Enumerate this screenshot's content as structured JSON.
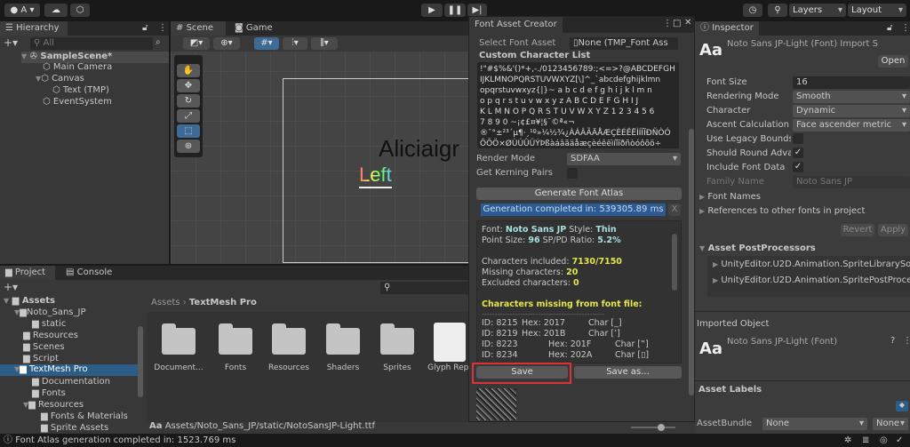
{
  "toolbar": {
    "account_label": "A",
    "play_icon": "play-icon",
    "pause_icon": "pause-icon",
    "step_icon": "step-icon",
    "layers": "Layers",
    "layout": "Layout"
  },
  "hierarchy": {
    "tab": "Hierarchy",
    "search_placeholder": "All",
    "items": [
      {
        "label": "SampleScene*"
      },
      {
        "label": "Main Camera"
      },
      {
        "label": "Canvas"
      },
      {
        "label": "Text (TMP)"
      },
      {
        "label": "EventSystem"
      }
    ]
  },
  "scene": {
    "tabs": [
      "Scene",
      "Game"
    ],
    "text1": "Aliciaigr",
    "text2": "Left"
  },
  "project": {
    "tabs": [
      "Project",
      "Console"
    ],
    "tree": [
      "Assets",
      "Noto_Sans_JP",
      "static",
      "Resources",
      "Scenes",
      "Script",
      "TextMesh Pro",
      "Documentation",
      "Fonts",
      "Resources",
      "Fonts & Materials",
      "Sprite Assets"
    ],
    "breadcrumb": [
      "Assets",
      "TextMesh Pro"
    ],
    "items": [
      "Document...",
      "Fonts",
      "Resources",
      "Shaders",
      "Sprites",
      "Glyph Repo"
    ],
    "footer_path": "Assets/Noto_Sans_JP/static/NotoSansJP-Light.ttf",
    "footer_icon": "Aa"
  },
  "status": {
    "message": "Font Atlas generation completed in: 1523.769 ms"
  },
  "fac": {
    "title": "Font Asset Creator",
    "select_label": "Select Font Asset",
    "select_value": "None (TMP_Font Ass",
    "ccl_label": "Custom Character List",
    "ccl_lines": [
      "!\"#$%&'()*+,-./0123456789:;<=>?@ABCDEFGH",
      "IJKLMNOPQRSTUVWXYZ[\\]^_`abcdefghijklmn",
      "opqrstuvwxyz{|}~ a b c d e f g h i j k l m n",
      "o p q r s t u v w x y z A B C D E F G H I J",
      "K L M N O P Q R S T U V W X Y Z 1 2 3 4 5 6",
      "7 8 9 0 ~¡¢£¤¥¦§¨©ª«¬",
      "®¯°±²³´µ¶·¸¹º»¼½¾¿ÀÁÂÃÄÅÆÇÈÉÊËÌÍÎÏÐÑÒÓ",
      "ÔÕÖ×ØÙÚÛÜÝÞßàáâãäåæçèéêëìíîïðñòóôõö÷"
    ],
    "render_mode_label": "Render Mode",
    "render_mode": "SDFAA",
    "kerning_label": "Get Kerning Pairs",
    "kerning": false,
    "generate": "Generate Font Atlas",
    "progress_text": "Generation completed in: 539305.89 ms",
    "progress": 1.0,
    "progress_close": "X",
    "info": {
      "font_label": "Font:",
      "font": "Noto Sans JP",
      "style_label": "Style:",
      "style": "Thin",
      "point_label": "Point Size:",
      "point": "96",
      "ratio_label": "SP/PD Ratio:",
      "ratio": "5.2%",
      "included_label": "Characters included:",
      "included": "7130/7150",
      "missing_label": "Missing characters:",
      "missing": "20",
      "excluded_label": "Excluded characters:",
      "excluded": "0",
      "missing_header": "Characters missing from font file:",
      "divider": "------------------------------------------------",
      "rows": [
        {
          "id": "8215",
          "hex": "2017",
          "char": "[_]"
        },
        {
          "id": "8219",
          "hex": "201B",
          "char": "[‛]"
        },
        {
          "id": "8223",
          "hex": "201F",
          "char": "[‟]"
        },
        {
          "id": "8234",
          "hex": "202A",
          "char": "[▯]"
        }
      ],
      "id_label": "ID:",
      "hex_label": "Hex:",
      "char_label": "Char"
    },
    "save": "Save",
    "save_as": "Save as..."
  },
  "inspector": {
    "tab": "Inspector",
    "title": "Noto Sans JP-Light (Font) Import S",
    "icon": "Aa",
    "open": "Open",
    "fields": [
      {
        "label": "Font Size",
        "value": "16",
        "type": "text"
      },
      {
        "label": "Rendering Mode",
        "value": "Smooth",
        "type": "dropdown"
      },
      {
        "label": "Character",
        "value": "Dynamic",
        "type": "dropdown"
      },
      {
        "label": "Ascent Calculation M",
        "value": "Face ascender metric",
        "type": "dropdown"
      },
      {
        "label": "Use Legacy Bounds",
        "value": false,
        "type": "check"
      },
      {
        "label": "Should Round Advar",
        "value": true,
        "type": "check"
      },
      {
        "label": "Include Font Data",
        "value": true,
        "type": "check"
      },
      {
        "label": "Family Name",
        "value": "Noto Sans JP",
        "type": "disabled"
      }
    ],
    "font_names": "Font Names",
    "references": "References to other fonts in project",
    "revert": "Revert",
    "apply": "Apply",
    "postprocessors": "Asset PostProcessors",
    "pp_items": [
      "UnityEditor.U2D.Animation.SpriteLibrarySourc",
      "UnityEditor.U2D.Animation.SpritePostProcess"
    ],
    "imported": "Imported Object",
    "imported_name": "Noto Sans JP-Light (Font)",
    "labels": "Asset Labels",
    "assetbundle": "AssetBundle",
    "bundle1": "None",
    "bundle2": "None"
  },
  "colors": {
    "selection": "#2c5d87",
    "progress": "#2b5a94",
    "highlight_box": "#e0313a",
    "yellow": "#e6e64a"
  }
}
